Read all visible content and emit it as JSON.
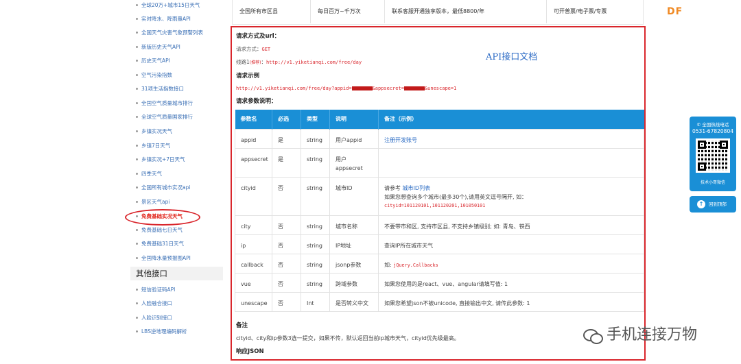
{
  "sidebar": {
    "items": [
      "全球20万+城市15日天气",
      "实时降水、降雨量API",
      "全国天气灾害气象预警列表",
      "新版历史天气API",
      "历史天气API",
      "空气污染指数",
      "31项生活指数接口",
      "全国空气质量城市排行",
      "全球空气质量国家排行",
      "乡镇实况天气",
      "乡镇7日天气",
      "乡镇实况+7日天气",
      "四季天气",
      "全国所有城市实况api",
      "景区天气api",
      "免费基础实况天气",
      "免费基础七日天气",
      "免费基础31日天气",
      "全国降水量预报图API"
    ],
    "active_index": 15,
    "other_header": "其他接口",
    "other_items": [
      "短信验证码API",
      "人脸融合接口",
      "人脸识别接口",
      "LBS逆地理编码解析"
    ]
  },
  "top_table": {
    "cells": [
      "全国所有市区县",
      "每日百万~千万次",
      "联系客服开通独享版本，最低8800/年",
      "可开普票/电子票/专票"
    ]
  },
  "doc": {
    "annotation": "API接口文档",
    "method_heading": "请求方式及url：",
    "method_label": "请求方式：",
    "method_value": "GET",
    "route_label": "线路1",
    "route_badge": "(推荐)",
    "route_sep": "：",
    "route_url": "http://v1.yiketianqi.com/free/day",
    "example_heading": "请求示例",
    "example_url_a": "http://v1.yiketianqi.com/free/day?appid=",
    "example_url_b": "&appsecret=",
    "example_url_c": "&unescape=1",
    "params_heading": "请求参数说明：",
    "columns": [
      "参数名",
      "必选",
      "类型",
      "说明",
      "备注（示例）"
    ],
    "rows": [
      {
        "name": "appid",
        "req": "是",
        "type": "string",
        "desc": "用户appid",
        "note": "",
        "note_link": "注册开发账号"
      },
      {
        "name": "appsecret",
        "req": "是",
        "type": "string",
        "desc": "用户appsecret",
        "note": "",
        "note_link": ""
      },
      {
        "name": "cityid",
        "req": "否",
        "type": "string",
        "desc": "城市ID",
        "note_prefix": "请参考 ",
        "note_link": "城市ID列表",
        "note": "如果您想查询多个城市(最多30个),请用英文逗号隔开, 如：",
        "note_code": "cityid=101120101,101120201,101050101"
      },
      {
        "name": "city",
        "req": "否",
        "type": "string",
        "desc": "城市名称",
        "note": "不要带市和区, 支持市区县, 不支持乡镇级别; 如: 青岛、铁西"
      },
      {
        "name": "ip",
        "req": "否",
        "type": "string",
        "desc": "IP地址",
        "note": "查询IP所在城市天气"
      },
      {
        "name": "callback",
        "req": "否",
        "type": "string",
        "desc": "jsonp参数",
        "note_prefix": "如: ",
        "note_code": "jQuery.Callbacks"
      },
      {
        "name": "vue",
        "req": "否",
        "type": "string",
        "desc": "跨域参数",
        "note": "如果您使用的是react、vue、angular请填写值: 1"
      },
      {
        "name": "unescape",
        "req": "否",
        "type": "Int",
        "desc": "是否转义中文",
        "note": "如果您希望json不被unicode, 直接输出中文, 请传此参数: 1"
      }
    ],
    "remark_heading": "备注",
    "remark_text": "cityid、city和ip参数3选一提交，如果不传，默认返回当前ip城市天气，cityid优先级最高。",
    "response_heading": "响应JSON"
  },
  "widgets": {
    "hotline_label": "全国热线电话",
    "hotline_number": "0531-67820804",
    "qr_caption": "技术小哥微信",
    "back_top": "回到顶部",
    "back_top_icon": "up-arrow-icon"
  },
  "logo": "DF",
  "watermark": "手机连接万物",
  "colors": {
    "accent_blue": "#1a8fd6",
    "highlight_red": "#d9262c",
    "link_blue": "#3a6fb5"
  }
}
